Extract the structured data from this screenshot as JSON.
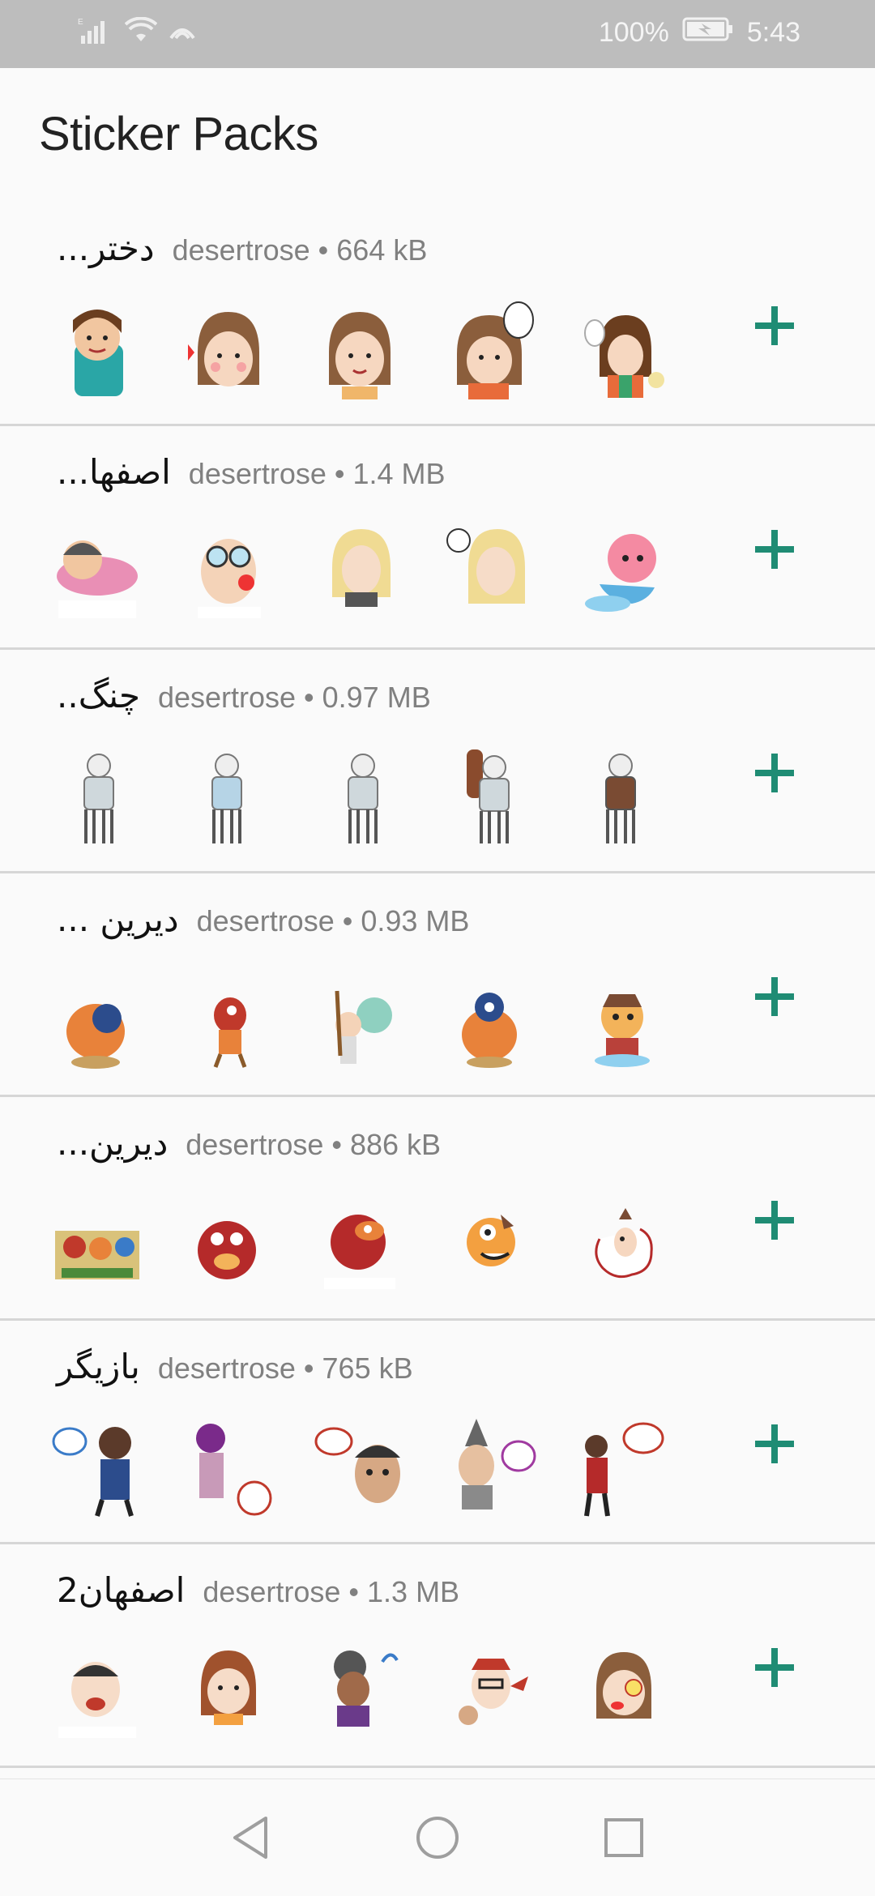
{
  "status_bar": {
    "battery": "100%",
    "time": "5:43"
  },
  "title": "Sticker Packs",
  "packs": [
    {
      "name": "دختر...",
      "publisher": "desertrose",
      "size": "664 kB"
    },
    {
      "name": "اصفها...",
      "publisher": "desertrose",
      "size": "1.4 MB"
    },
    {
      "name": "چنگ..",
      "publisher": "desertrose",
      "size": "0.97 MB"
    },
    {
      "name": "دیرین ...",
      "publisher": "desertrose",
      "size": "0.93 MB"
    },
    {
      "name": "دیرین...",
      "publisher": "desertrose",
      "size": "886 kB"
    },
    {
      "name": "بازیگر",
      "publisher": "desertrose",
      "size": "765 kB"
    },
    {
      "name": "اصفهان2",
      "publisher": "desertrose",
      "size": "1.3 MB"
    }
  ],
  "separator": "•",
  "colors": {
    "accent": "#1f8c74",
    "status_bar": "#bdbdbd",
    "background": "#fafafa"
  }
}
